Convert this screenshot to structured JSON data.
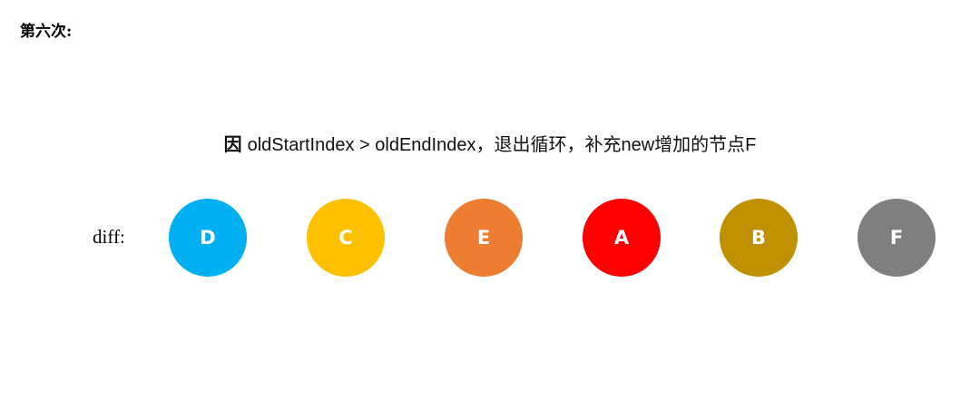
{
  "step_title": "第六次:",
  "caption": {
    "lead": "因",
    "text": "oldStartIndex > oldEndIndex，退出循环，补充new增加的节点F"
  },
  "row_label": "diff:",
  "nodes": [
    {
      "label": "D",
      "color": "#00B0F0"
    },
    {
      "label": "C",
      "color": "#FFC000"
    },
    {
      "label": "E",
      "color": "#ED7D31"
    },
    {
      "label": "A",
      "color": "#FF0000"
    },
    {
      "label": "B",
      "color": "#BF9000"
    },
    {
      "label": "F",
      "color": "#7F7F7F"
    }
  ]
}
